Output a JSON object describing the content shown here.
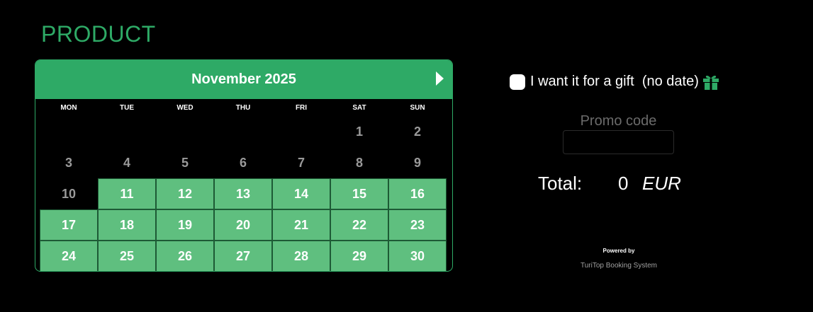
{
  "product": {
    "title": "PRODUCT"
  },
  "calendar": {
    "month_label": "November 2025",
    "next_icon": "chevron-right-icon",
    "weekdays": [
      "MON",
      "TUE",
      "WED",
      "THU",
      "FRI",
      "SAT",
      "SUN"
    ],
    "leading_blanks": 5,
    "days": [
      {
        "label": "1",
        "available": false
      },
      {
        "label": "2",
        "available": false
      },
      {
        "label": "3",
        "available": false
      },
      {
        "label": "4",
        "available": false
      },
      {
        "label": "5",
        "available": false
      },
      {
        "label": "6",
        "available": false
      },
      {
        "label": "7",
        "available": false
      },
      {
        "label": "8",
        "available": false
      },
      {
        "label": "9",
        "available": false
      },
      {
        "label": "10",
        "available": false
      },
      {
        "label": "11",
        "available": true
      },
      {
        "label": "12",
        "available": true
      },
      {
        "label": "13",
        "available": true
      },
      {
        "label": "14",
        "available": true
      },
      {
        "label": "15",
        "available": true
      },
      {
        "label": "16",
        "available": true
      },
      {
        "label": "17",
        "available": true
      },
      {
        "label": "18",
        "available": true
      },
      {
        "label": "19",
        "available": true
      },
      {
        "label": "20",
        "available": true
      },
      {
        "label": "21",
        "available": true
      },
      {
        "label": "22",
        "available": true
      },
      {
        "label": "23",
        "available": true
      },
      {
        "label": "24",
        "available": true
      },
      {
        "label": "25",
        "available": true
      },
      {
        "label": "26",
        "available": true
      },
      {
        "label": "27",
        "available": true
      },
      {
        "label": "28",
        "available": true
      },
      {
        "label": "29",
        "available": true
      },
      {
        "label": "30",
        "available": true
      }
    ]
  },
  "gift": {
    "label": "I want it for a gift  (no date)",
    "checked": false,
    "icon": "gift-icon"
  },
  "promo": {
    "label": "Promo code",
    "value": "",
    "placeholder": ""
  },
  "total": {
    "label": "Total:",
    "value": "0",
    "currency": "EUR"
  },
  "footer": {
    "powered_by": "Powered by",
    "system_name": "TuriTop Booking System"
  },
  "colors": {
    "brand_green": "#2eaa66",
    "available_day": "#5fbf7f",
    "unavailable_day_text": "#9a9a9a",
    "background": "#000000"
  }
}
